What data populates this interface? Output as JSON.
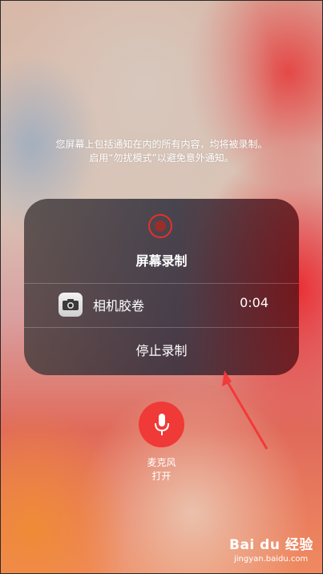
{
  "warning": {
    "line1": "您屏幕上包括通知在内的所有内容，均将被录制。",
    "line2": "启用“勿扰模式”以避免意外通知。"
  },
  "panel": {
    "title": "屏幕录制",
    "destination": {
      "label": "相机胶卷",
      "time": "0:04",
      "icon": "camera-icon"
    },
    "stop_label": "停止录制",
    "record_icon": "record-icon",
    "accent_color": "#f03a38"
  },
  "mic": {
    "icon": "microphone-icon",
    "label": "麦克风",
    "state": "打开"
  },
  "watermark": {
    "main": "Bai du 经验",
    "sub": "jingyan.baidu.com"
  }
}
